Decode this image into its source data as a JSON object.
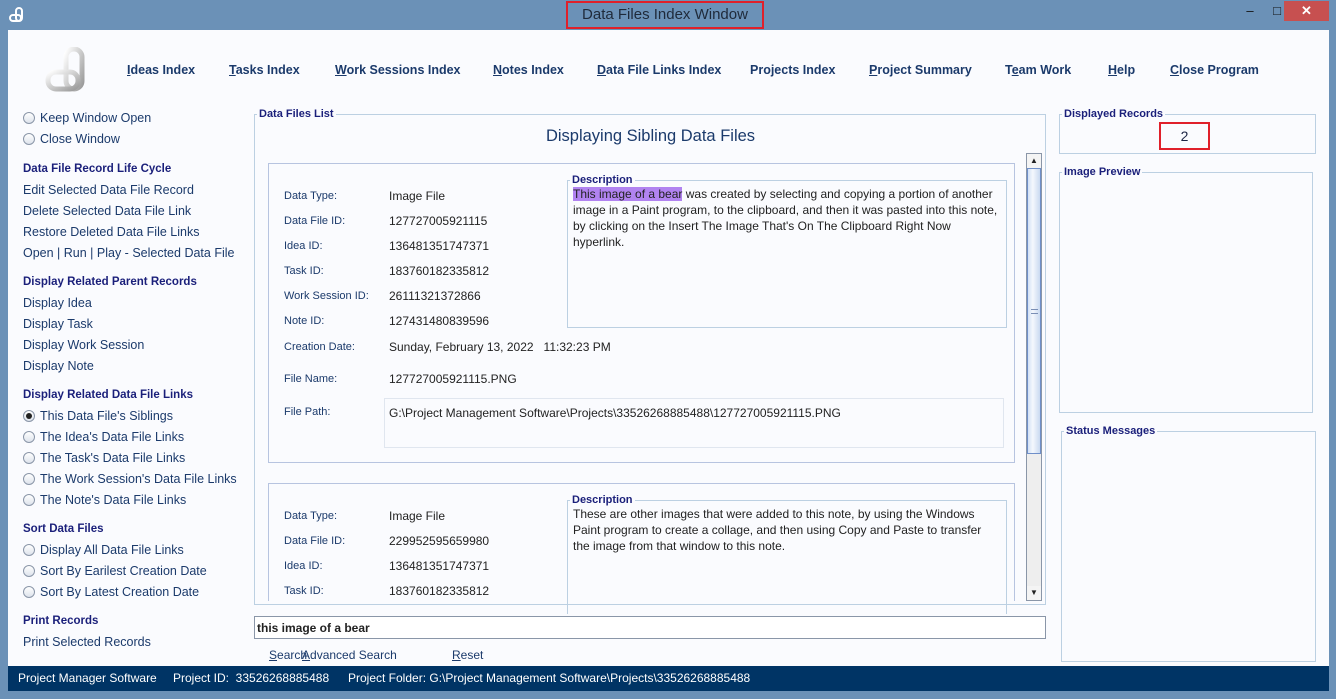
{
  "window": {
    "title": "Data Files Index Window",
    "minimize": "–",
    "maximize": "□",
    "close": "✕"
  },
  "nav": [
    {
      "u": "I",
      "rest": "deas Index"
    },
    {
      "u": "T",
      "rest": "asks Index"
    },
    {
      "u": "W",
      "rest": "ork Sessions Index"
    },
    {
      "u": "N",
      "rest": "otes Index"
    },
    {
      "u": "D",
      "rest": "ata File Links Index"
    },
    {
      "u": "",
      "rest": "Projects Index"
    },
    {
      "u": "P",
      "rest": "roject Summary"
    },
    {
      "pre": "T",
      "u": "e",
      "rest": "am Work"
    },
    {
      "u": "H",
      "rest": "elp"
    },
    {
      "u": "C",
      "rest": "lose Program"
    }
  ],
  "sidebar": {
    "window_options": [
      {
        "label": "Keep Window Open",
        "checked": false
      },
      {
        "label": "Close Window",
        "checked": false
      }
    ],
    "life_cycle": {
      "header": "Data File Record Life Cycle",
      "items": [
        "Edit Selected Data File Record",
        "Delete Selected Data File Link",
        "Restore Deleted Data File Links",
        "Open | Run | Play - Selected Data File"
      ]
    },
    "parent_records": {
      "header": "Display Related Parent Records",
      "items": [
        "Display Idea",
        "Display Task",
        "Display Work Session",
        "Display Note"
      ]
    },
    "related_links": {
      "header": "Display Related Data File Links",
      "items": [
        {
          "label": "This Data File's Siblings",
          "checked": true
        },
        {
          "label": "The Idea's Data File Links",
          "checked": false
        },
        {
          "label": "The Task's Data File Links",
          "checked": false
        },
        {
          "label": "The Work Session's Data File Links",
          "checked": false
        },
        {
          "label": "The Note's Data File Links",
          "checked": false
        }
      ]
    },
    "sort": {
      "header": "Sort Data Files",
      "items": [
        {
          "label": "Display All Data File Links",
          "checked": false
        },
        {
          "label": "Sort By Earilest Creation Date",
          "checked": false
        },
        {
          "label": "Sort By Latest Creation Date",
          "checked": false
        }
      ]
    },
    "print": {
      "header": "Print Records",
      "items": [
        "Print Selected Records"
      ]
    }
  },
  "list": {
    "legend": "Data Files List",
    "title": "Displaying Sibling Data Files",
    "labels": {
      "data_type": "Data Type:",
      "data_file_id": "Data File ID:",
      "idea_id": "Idea ID:",
      "task_id": "Task ID:",
      "work_session_id": "Work Session ID:",
      "note_id": "Note ID:",
      "creation_date": "Creation Date:",
      "file_name": "File Name:",
      "file_path": "File Path:",
      "description": "Description"
    },
    "records": [
      {
        "data_type": "Image File",
        "data_file_id": "127727005921115",
        "idea_id": "136481351747371",
        "task_id": "183760182335812",
        "work_session_id": "26111321372866",
        "note_id": "127431480839596",
        "creation_date": "Sunday, February 13, 2022   11:32:23 PM",
        "file_name": "127727005921115.PNG",
        "file_path": "G:\\Project Management Software\\Projects\\33526268885488\\127727005921115.PNG",
        "description_highlight": "This image of a bear",
        "description_rest": " was created by selecting and copying a portion of another image in a Paint program, to the clipboard, and then it was pasted into this note, by clicking on the Insert The Image That's On The Clipboard Right Now hyperlink."
      },
      {
        "data_type": "Image File",
        "data_file_id": "229952595659980",
        "idea_id": "136481351747371",
        "task_id": "183760182335812",
        "description": "These are other images that were added to this note, by using the Windows Paint program to create a collage, and then using Copy and Paste to transfer the image from that window to this note."
      }
    ]
  },
  "search": {
    "value": "this image of a bear",
    "buttons": [
      {
        "u": "S",
        "rest": "earch"
      },
      {
        "u": "A",
        "rest": "dvanced Search"
      },
      {
        "u": "R",
        "rest": "eset"
      }
    ]
  },
  "right": {
    "displayed_records_legend": "Displayed Records",
    "displayed_records": "2",
    "image_preview_legend": "Image Preview",
    "status_messages_legend": "Status Messages"
  },
  "statusbar": {
    "app": "Project Manager Software",
    "project_id": "Project ID:  33526268885488",
    "project_folder": "Project Folder: G:\\Project Management Software\\Projects\\33526268885488"
  }
}
